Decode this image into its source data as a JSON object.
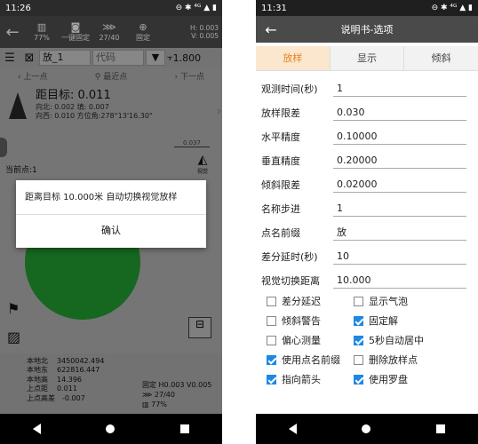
{
  "left": {
    "status": {
      "time": "11:26",
      "icons": "⊖ ✱ ⁴ᴳ ▲ ▮"
    },
    "toolbar": {
      "items": [
        {
          "icon": "▥",
          "label": "77%"
        },
        {
          "icon": "◙",
          "label": "一键固定"
        },
        {
          "icon": "⋙",
          "label": "27/40"
        },
        {
          "icon": "⊕",
          "label": "固定"
        }
      ],
      "h": "H: 0.003",
      "v": "V: 0.005"
    },
    "row2": {
      "point_name": "放_1",
      "code_placeholder": "代码",
      "height": "1.800"
    },
    "nav": {
      "prev": "上一点",
      "nearest": "最近点",
      "next": "下一点"
    },
    "target": {
      "distance": "距目标: 0.011",
      "line1": "向北: 0.002 填: 0.007",
      "line2": "向西: 0.010 方位角:278°13'16.30\""
    },
    "scale": "0.037",
    "current_point": "当前点:1",
    "view_label": "视觉",
    "dialog": {
      "message": "距离目标 10.000米 自动切换视觉放样",
      "confirm": "确认"
    },
    "info": {
      "rows": [
        {
          "k": "本地北",
          "v": "3450042.494"
        },
        {
          "k": "本地东",
          "v": "622816.447"
        },
        {
          "k": "本地高",
          "v": "14.396"
        },
        {
          "k": "上点距",
          "v": "0.011"
        },
        {
          "k": "上点高差",
          "v": "-0.007"
        }
      ],
      "right": [
        "固定 H0.003 V0.005",
        "⋙ 27/40",
        "▥ 77%"
      ]
    }
  },
  "right": {
    "status": {
      "time": "11:31",
      "icons": "⊖ ✱ ⁴ᴳ ▲ ▮"
    },
    "title": "说明书-选项",
    "tabs": [
      "放样",
      "显示",
      "倾斜"
    ],
    "fields": [
      {
        "label": "观测时间(秒)",
        "value": "1"
      },
      {
        "label": "放样限差",
        "value": "0.030"
      },
      {
        "label": "水平精度",
        "value": "0.10000"
      },
      {
        "label": "垂直精度",
        "value": "0.20000"
      },
      {
        "label": "倾斜限差",
        "value": "0.02000"
      },
      {
        "label": "名称步进",
        "value": "1"
      },
      {
        "label": "点名前缀",
        "value": "放"
      },
      {
        "label": "差分延时(秒)",
        "value": "10"
      },
      {
        "label": "视觉切换距离",
        "value": "10.000"
      }
    ],
    "checks": [
      [
        {
          "label": "差分延迟",
          "checked": false
        },
        {
          "label": "显示气泡",
          "checked": false
        }
      ],
      [
        {
          "label": "倾斜警告",
          "checked": false
        },
        {
          "label": "固定解",
          "checked": true
        }
      ],
      [
        {
          "label": "偏心测量",
          "checked": false
        },
        {
          "label": "5秒自动居中",
          "checked": true
        }
      ],
      [
        {
          "label": "使用点名前缀",
          "checked": true
        },
        {
          "label": "删除放样点",
          "checked": false
        }
      ],
      [
        {
          "label": "指向箭头",
          "checked": true
        },
        {
          "label": "使用罗盘",
          "checked": true
        }
      ]
    ]
  }
}
